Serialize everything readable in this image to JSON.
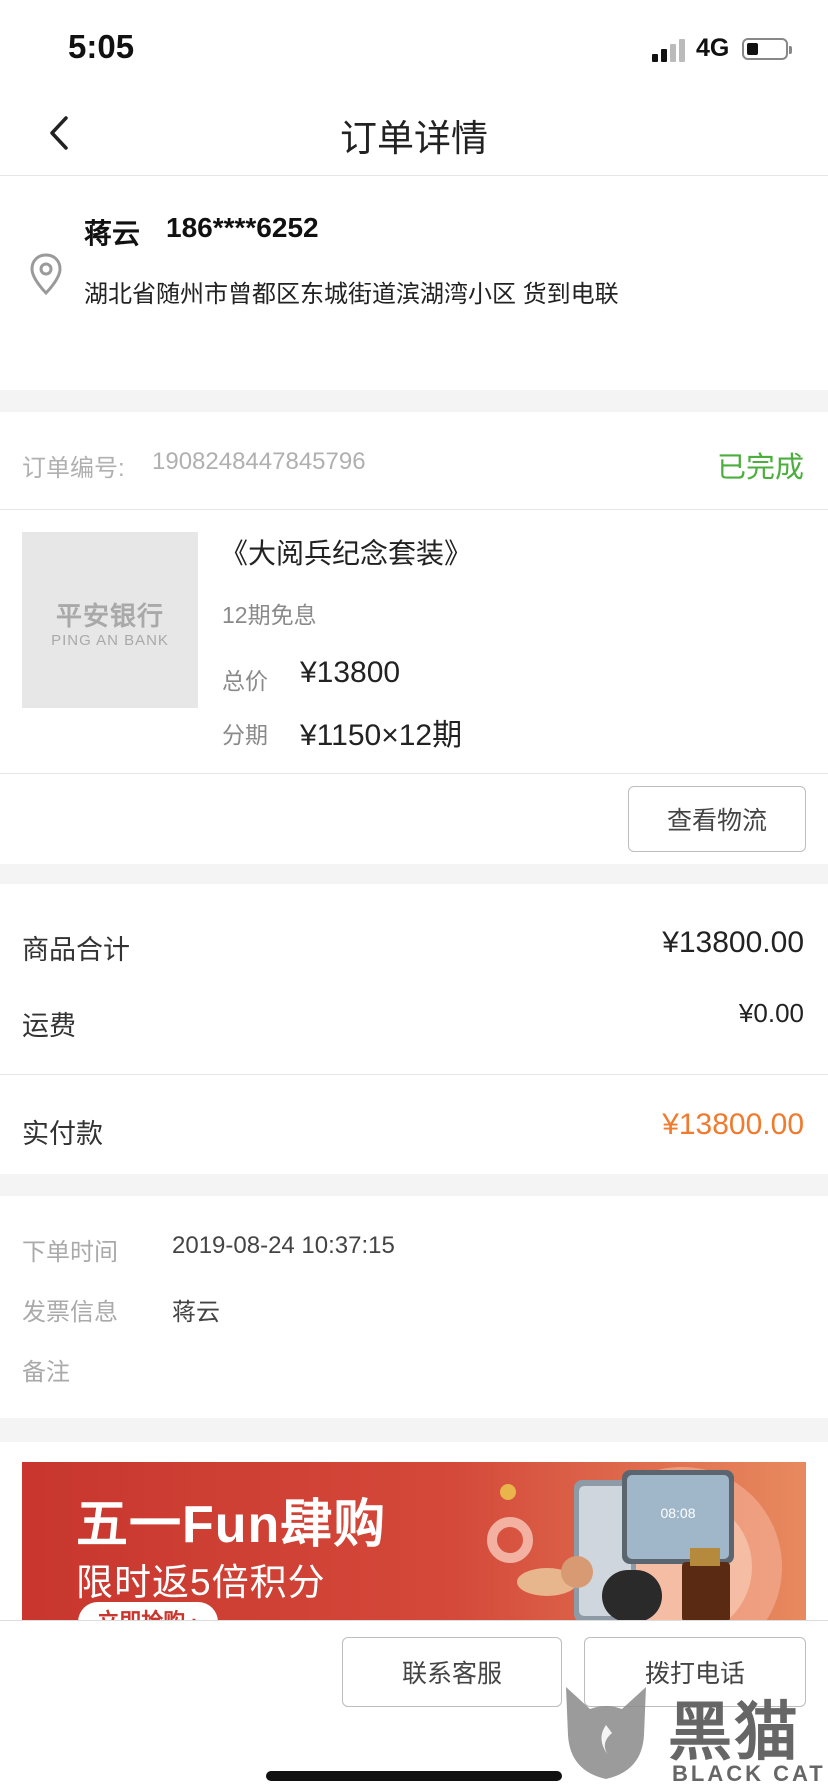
{
  "status_bar": {
    "time": "5:05",
    "network": "4G"
  },
  "nav": {
    "title": "订单详情"
  },
  "address": {
    "name": "蒋云",
    "phone": "186****6252",
    "line": "湖北省随州市曾都区东城街道滨湖湾小区 货到电联"
  },
  "order": {
    "number_label": "订单编号:",
    "number": "1908248447845796",
    "status": "已完成",
    "status_color": "#4caf3d"
  },
  "product": {
    "thumb_cn": "平安银行",
    "thumb_en": "PING AN BANK",
    "title": "《大阅兵纪念套装》",
    "subtitle": "12期免息",
    "total_label": "总价",
    "total_value": "¥13800",
    "install_label": "分期",
    "install_value": "¥1150×12期"
  },
  "logistics_button": "查看物流",
  "summary": {
    "goods_label": "商品合计",
    "goods_value": "¥13800.00",
    "shipping_label": "运费",
    "shipping_value": "¥0.00",
    "paid_label": "实付款",
    "paid_value": "¥13800.00",
    "paid_color": "#f07a2e"
  },
  "info": {
    "time_label": "下单时间",
    "time_value": "2019-08-24 10:37:15",
    "invoice_label": "发票信息",
    "invoice_value": "蒋云",
    "remark_label": "备注"
  },
  "banner": {
    "headline": "五一Fun肆购",
    "subline": "限时返5倍积分",
    "cta": "立即抢购 ›"
  },
  "bottom": {
    "contact_button": "联系客服",
    "call_button": "拨打电话"
  },
  "watermark": {
    "cn": "黑猫",
    "en": "BLACK CAT"
  }
}
